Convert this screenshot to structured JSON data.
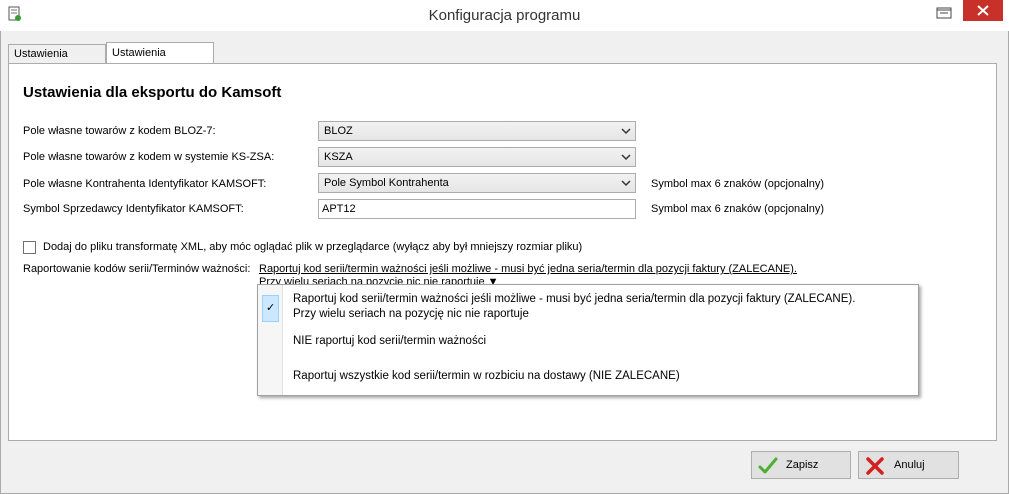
{
  "window": {
    "title": "Konfiguracja programu"
  },
  "tabs": [
    {
      "label": "Ustawienia ogólne",
      "active": false
    },
    {
      "label": "Ustawienia Kamsoft",
      "active": true
    }
  ],
  "section": {
    "heading": "Ustawienia dla eksportu do Kamsoft"
  },
  "fields": [
    {
      "label": "Pole własne towarów z kodem BLOZ-7:",
      "value": "BLOZ",
      "type": "select"
    },
    {
      "label": "Pole własne towarów z kodem w systemie KS-ZSA:",
      "value": "KSZA",
      "type": "select"
    },
    {
      "label": "Pole własne Kontrahenta Identyfikator KAMSOFT:",
      "value": "Pole Symbol Kontrahenta",
      "type": "select",
      "note": "Symbol max 6 znaków (opcjonalny)"
    },
    {
      "label": "Symbol Sprzedawcy Identyfikator KAMSOFT:",
      "value": "APT12",
      "type": "text",
      "note": "Symbol max 6 znaków (opcjonalny)"
    }
  ],
  "xml_option": {
    "label": "Dodaj do pliku transformatę XML, aby móc oglądać plik w przeglądarce (wyłącz aby był mniejszy rozmiar pliku)",
    "checked": false
  },
  "serial_reporting": {
    "label": "Raportowanie kodów serii/Terminów ważności:",
    "selected_line1": "Raportuj kod serii/termin ważności jeśli możliwe - musi być jedna seria/termin dla pozycji faktury (ZALECANE).",
    "selected_line2": "Przy wielu seriach na pozycję nic nie raportuje",
    "dropdown_arrow": "▼",
    "options": [
      {
        "line1": "Raportuj kod serii/termin ważności jeśli możliwe - musi być jedna seria/termin dla pozycji faktury (ZALECANE).",
        "line2": "Przy wielu seriach na pozycję nic nie raportuje",
        "checked": true
      },
      {
        "line1": "NIE raportuj kod serii/termin ważności",
        "checked": false
      },
      {
        "line1": "Raportuj wszystkie kod serii/termin w rozbiciu na dostawy (NIE ZALECANE)",
        "checked": false
      }
    ],
    "check_glyph": "✓"
  },
  "buttons": {
    "save_label": "Zapisz",
    "cancel_label": "Anuluj"
  },
  "colors": {
    "close_button": "#c7312a",
    "selection": "#cce8ff",
    "save_icon": "#4caf32",
    "cancel_icon": "#d32020"
  }
}
